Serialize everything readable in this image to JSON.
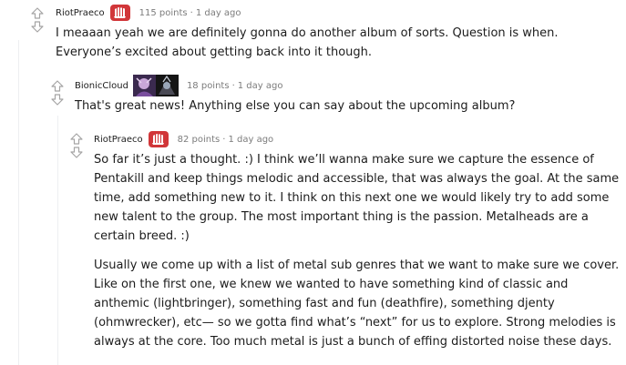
{
  "comments": [
    {
      "author": "RiotPraeco",
      "points": "115 points",
      "separator": "·",
      "time": "1 day ago",
      "flair_icon": "riot-fist-icon",
      "paragraphs": [
        "I meaaan yeah we are definitely gonna do another album of sorts. Question is when. Everyone’s excited about getting back into it though."
      ]
    },
    {
      "author": "BionicCloud",
      "points": "18 points",
      "separator": "·",
      "time": "1 day ago",
      "flair_icon": "champion-avatars-icon",
      "paragraphs": [
        "That's great news! Anything else you can say about the upcoming album?"
      ]
    },
    {
      "author": "RiotPraeco",
      "points": "82 points",
      "separator": "·",
      "time": "1 day ago",
      "flair_icon": "riot-fist-icon",
      "paragraphs": [
        "So far it’s just a thought. :) I think we’ll wanna make sure we capture the essence of Pentakill and keep things melodic and accessible, that was always the goal. At the same time, add something new to it. I think on this next one we would likely try to add some new talent to the group. The most important thing is the passion. Metalheads are a certain breed. :)",
        "Usually we come up with a list of metal sub genres that we want to make sure we cover. Like on the first one, we knew we wanted to have something kind of classic and anthemic (lightbringer), something fast and fun (deathfire), something djenty (ohmwrecker), etc— so we gotta find what’s “next” for us to explore. Strong melodies is always at the core. Too much metal is just a bunch of effing distorted noise these days."
      ]
    }
  ],
  "colors": {
    "riot_red": "#d13639",
    "text": "#1c1c1c",
    "meta_text": "#7c7c7c",
    "arrow": "#a5a4a4",
    "thread_line": "#edeff1"
  }
}
